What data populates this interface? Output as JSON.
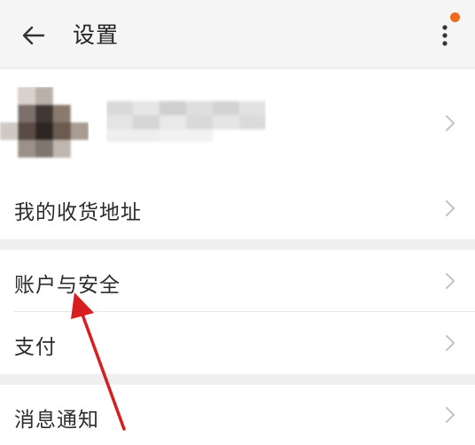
{
  "header": {
    "title": "设置",
    "back_icon": "arrow-left-icon",
    "more_icon": "more-vertical-icon",
    "notification_dot_color": "#f06a1f"
  },
  "settings": {
    "address_label": "我的收货地址",
    "account_security_label": "账户与安全",
    "payment_label": "支付",
    "notifications_label": "消息通知"
  },
  "annotation": {
    "arrow_color": "#d81e1e",
    "points_to": "账户与安全"
  }
}
